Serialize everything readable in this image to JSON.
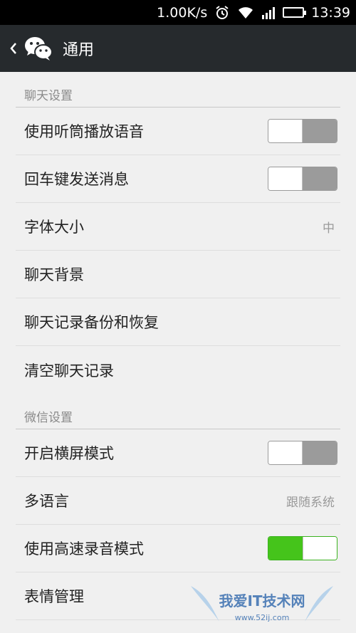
{
  "status": {
    "speed": "1.00K/s",
    "time": "13:39"
  },
  "header": {
    "title": "通用"
  },
  "sections": {
    "chat": {
      "title": "聊天设置",
      "earpiece": "使用听筒播放语音",
      "enter_send": "回车键发送消息",
      "font_size": "字体大小",
      "font_size_value": "中",
      "background": "聊天背景",
      "backup": "聊天记录备份和恢复",
      "clear": "清空聊天记录"
    },
    "wechat": {
      "title": "微信设置",
      "landscape": "开启横屏模式",
      "language": "多语言",
      "language_value": "跟随系统",
      "hq_record": "使用高速录音模式",
      "emoji": "表情管理"
    }
  },
  "toggles": {
    "earpiece": false,
    "enter_send": false,
    "landscape": false,
    "hq_record": true
  },
  "watermark": {
    "text": "我爱IT技术网",
    "url": "www.52ij.com"
  },
  "colors": {
    "titlebar": "#262a2d",
    "toggle_on": "#45c41b",
    "toggle_off": "#9b9b9b",
    "background": "#f0f0f0"
  }
}
